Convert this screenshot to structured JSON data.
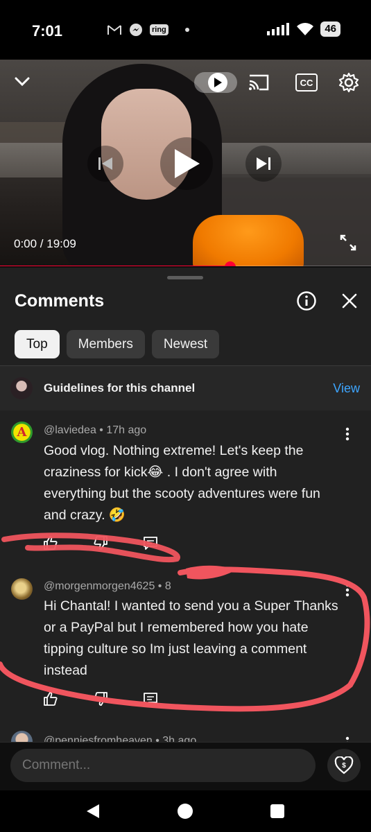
{
  "status_bar": {
    "time": "7:01",
    "ring_label": "ring",
    "battery": "46"
  },
  "video": {
    "time_display": "0:00 / 19:09",
    "progress_fraction": 0.62,
    "cc_label": "CC"
  },
  "comments_panel": {
    "title": "Comments",
    "chips": [
      {
        "label": "Top",
        "active": true
      },
      {
        "label": "Members",
        "active": false
      },
      {
        "label": "Newest",
        "active": false
      }
    ],
    "guidelines": {
      "text": "Guidelines for this channel",
      "view_label": "View"
    }
  },
  "comments": [
    {
      "author_line": "@laviedea • 17h ago",
      "body": "Good vlog. Nothing extreme! Let's keep the craziness  for kick😂 . I don't  agree with everything but the scooty adventures were fun and crazy. 🤣"
    },
    {
      "author_line": "@morgenmorgen4625 • 8",
      "body": "Hi Chantal! I wanted to send you a Super Thanks or a PayPal but I remembered how you hate tipping culture so Im just leaving a comment instead"
    },
    {
      "author_line": "@penniesfromheaven • 3h ago",
      "body": ""
    }
  ],
  "composer": {
    "placeholder": "Comment..."
  },
  "colors": {
    "accent_red": "#ff0033",
    "link_blue": "#3ea6ff",
    "annotation_red": "#f0555e"
  }
}
